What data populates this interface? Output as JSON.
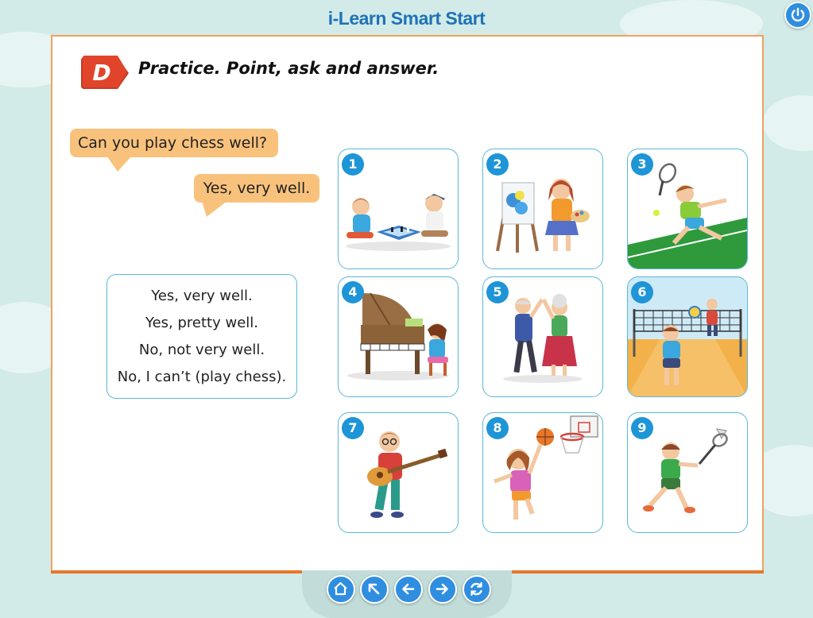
{
  "app": {
    "title": "i-Learn Smart Start"
  },
  "exercise": {
    "badge_letter": "D",
    "instruction": "Practice. Point, ask and answer."
  },
  "dialogue": {
    "question": "Can you play chess well?",
    "answer": "Yes, very well."
  },
  "answers": [
    "Yes, very well.",
    "Yes, pretty well.",
    "No, not very well.",
    "No, I can’t (play chess)."
  ],
  "cards": [
    {
      "number": "1",
      "activity": "chess"
    },
    {
      "number": "2",
      "activity": "painting"
    },
    {
      "number": "3",
      "activity": "tennis"
    },
    {
      "number": "4",
      "activity": "piano"
    },
    {
      "number": "5",
      "activity": "dancing"
    },
    {
      "number": "6",
      "activity": "volleyball"
    },
    {
      "number": "7",
      "activity": "guitar"
    },
    {
      "number": "8",
      "activity": "basketball"
    },
    {
      "number": "9",
      "activity": "badminton"
    }
  ],
  "nav": {
    "buttons": [
      "home-icon",
      "arrow-up-left-icon",
      "arrow-left-icon",
      "arrow-right-icon",
      "refresh-icon"
    ]
  },
  "colors": {
    "accent": "#2f8ee0",
    "badge": "#e0452b",
    "bubble": "#f9c27c",
    "border": "#5bb8d8",
    "page_border": "#f0a25a"
  }
}
